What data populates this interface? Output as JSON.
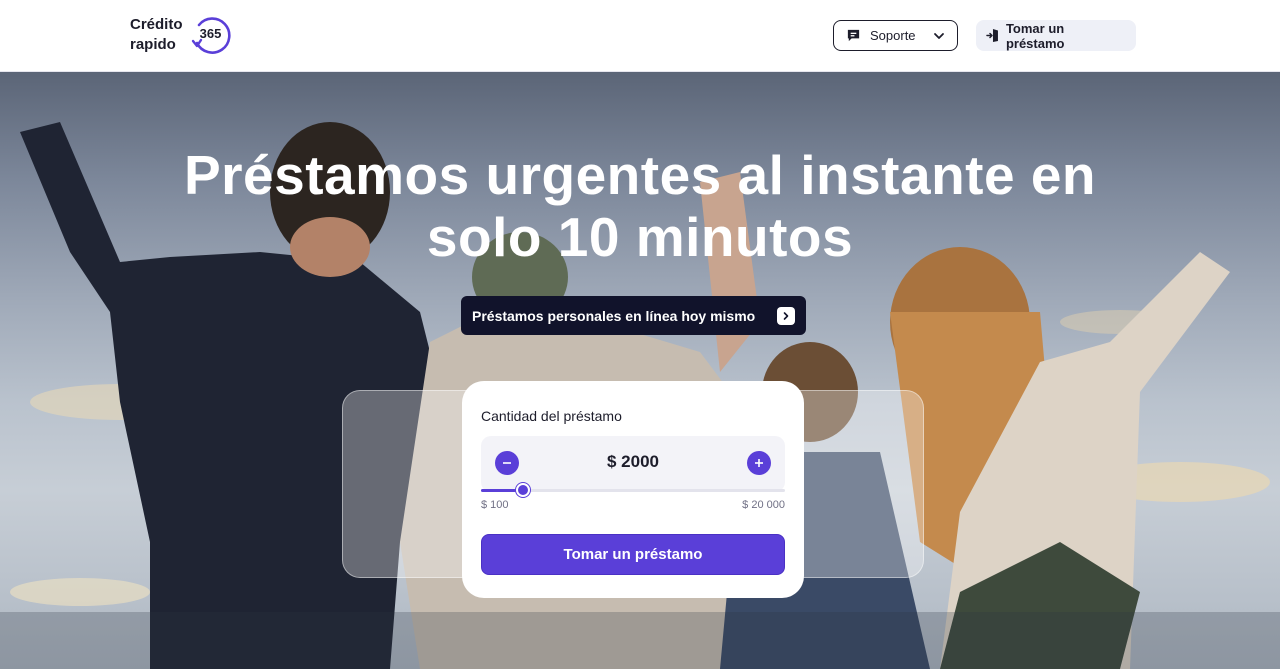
{
  "brand": {
    "line1": "Crédito",
    "line2": "rapido",
    "badge": "365",
    "accent": "#5a3fd8"
  },
  "nav": {
    "support_label": "Soporte",
    "support_icon": "chat-icon",
    "loan_label": "Tomar un préstamo",
    "loan_icon": "login-door-icon"
  },
  "hero": {
    "title": "Préstamos urgentes al instante en solo 10 minutos",
    "pill_label": "Préstamos personales en línea hoy mismo",
    "pill_icon": "chevron-right-icon"
  },
  "calculator": {
    "title": "Cantidad del préstamo",
    "amount": "$ 2000",
    "min_label": "$ 100",
    "max_label": "$ 20 000",
    "slider_value_fraction": 0.095,
    "decrease_icon": "minus-icon",
    "increase_icon": "plus-icon",
    "cta_label": "Tomar un préstamo"
  },
  "colors": {
    "dark": "#11132b",
    "text": "#1d1d2b",
    "muted": "#707085"
  }
}
